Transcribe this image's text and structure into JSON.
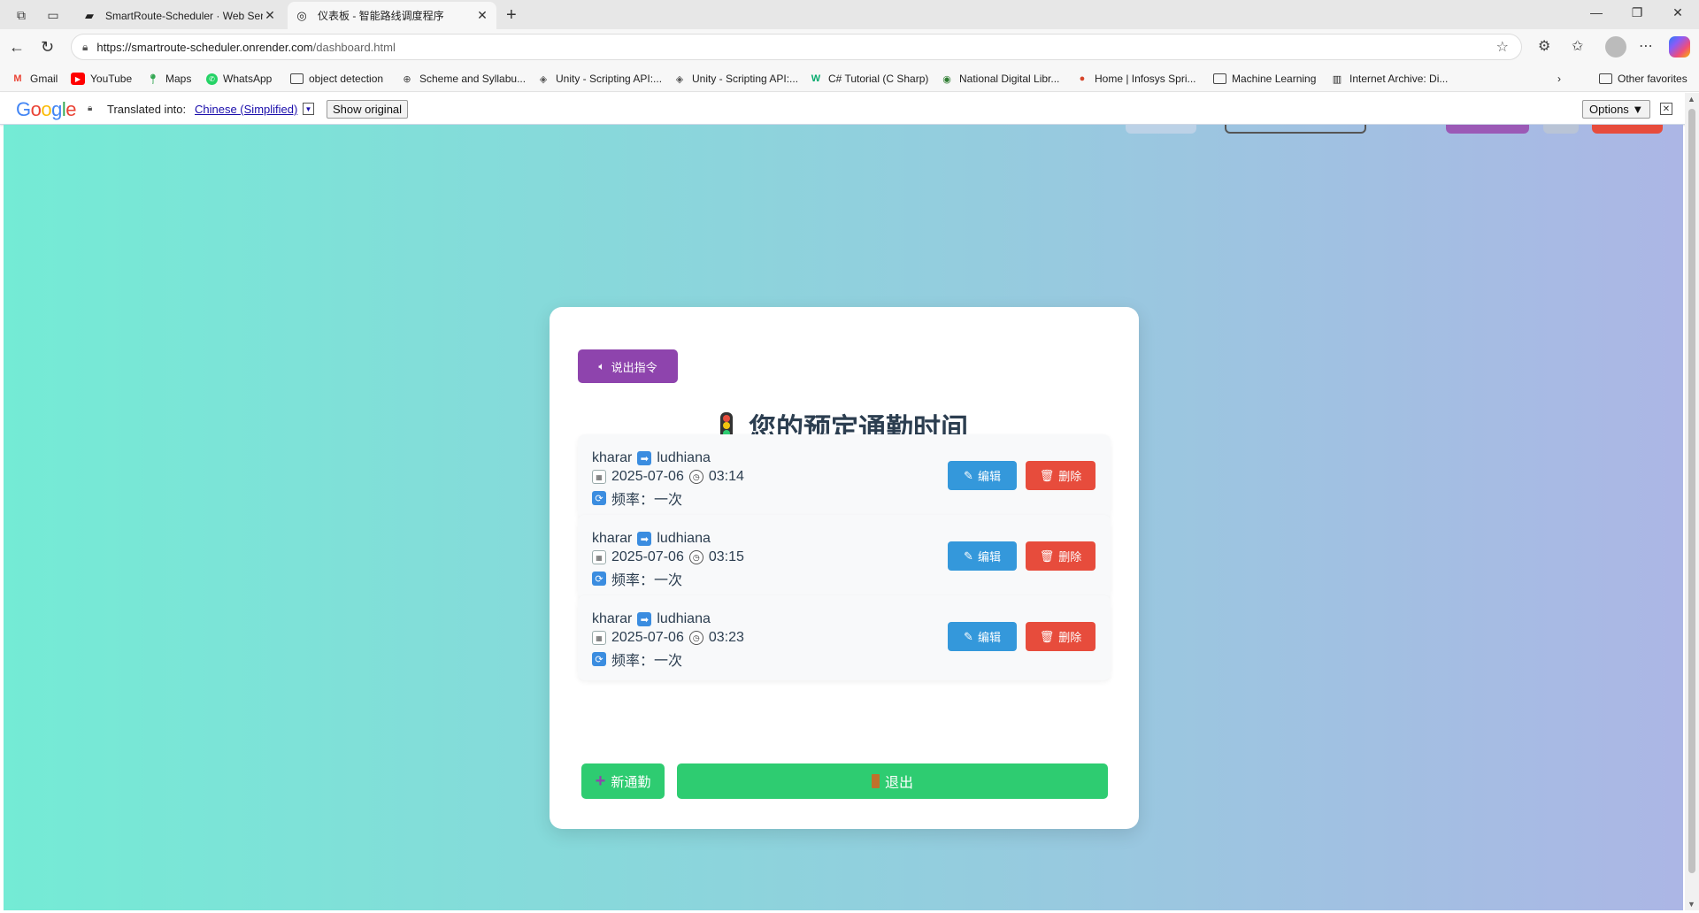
{
  "browser": {
    "tabs": [
      {
        "title": "SmartRoute-Scheduler · Web Ser",
        "active": false
      },
      {
        "title": "仪表板 - 智能路线调度程序",
        "active": true
      }
    ],
    "url_host": "https://smartroute-scheduler.onrender.com",
    "url_path": "/dashboard.html",
    "bookmarks": [
      {
        "label": "Gmail",
        "icon": "gmail-icon"
      },
      {
        "label": "YouTube",
        "icon": "youtube-icon"
      },
      {
        "label": "Maps",
        "icon": "maps-icon"
      },
      {
        "label": "WhatsApp",
        "icon": "whatsapp-icon"
      },
      {
        "label": "object detection",
        "icon": "folder-icon"
      },
      {
        "label": "Scheme and Syllabu...",
        "icon": "globe-icon"
      },
      {
        "label": "Unity - Scripting API:...",
        "icon": "unity-icon"
      },
      {
        "label": "Unity - Scripting API:...",
        "icon": "unity-icon"
      },
      {
        "label": "C# Tutorial (C Sharp)",
        "icon": "w3schools-icon"
      },
      {
        "label": "National Digital Libr...",
        "icon": "ndl-icon"
      },
      {
        "label": "Home | Infosys Spri...",
        "icon": "infosys-icon"
      },
      {
        "label": "Machine Learning",
        "icon": "folder-icon"
      },
      {
        "label": "Internet Archive: Di...",
        "icon": "archive-icon"
      }
    ],
    "other_favorites": "Other favorites"
  },
  "translate_bar": {
    "label": "Translated into:",
    "language": "Chinese (Simplified)",
    "dropdown_arrow": "▼",
    "show_original": "Show original",
    "options": "Options ▼",
    "close": "✕"
  },
  "dashboard": {
    "voice_button": "说出指令",
    "title": "您的预定通勤时间",
    "commutes": [
      {
        "origin": "kharar",
        "destination": "ludhiana",
        "date": "2025-07-06",
        "time": "03:14",
        "frequency": "频率：一次"
      },
      {
        "origin": "kharar",
        "destination": "ludhiana",
        "date": "2025-07-06",
        "time": "03:15",
        "frequency": "频率：一次"
      },
      {
        "origin": "kharar",
        "destination": "ludhiana",
        "date": "2025-07-06",
        "time": "03:23",
        "frequency": "频率：一次"
      }
    ],
    "edit_label": "编辑",
    "delete_label": "删除",
    "new_commute": "新通勤",
    "logout": "退出"
  },
  "colors": {
    "gradient_start": "#74ebd5",
    "gradient_end": "#acb6e5",
    "voice": "#8e44ad",
    "edit": "#3498db",
    "delete": "#e74c3c",
    "action_green": "#2ecc71",
    "title_text": "#2c3e50"
  }
}
